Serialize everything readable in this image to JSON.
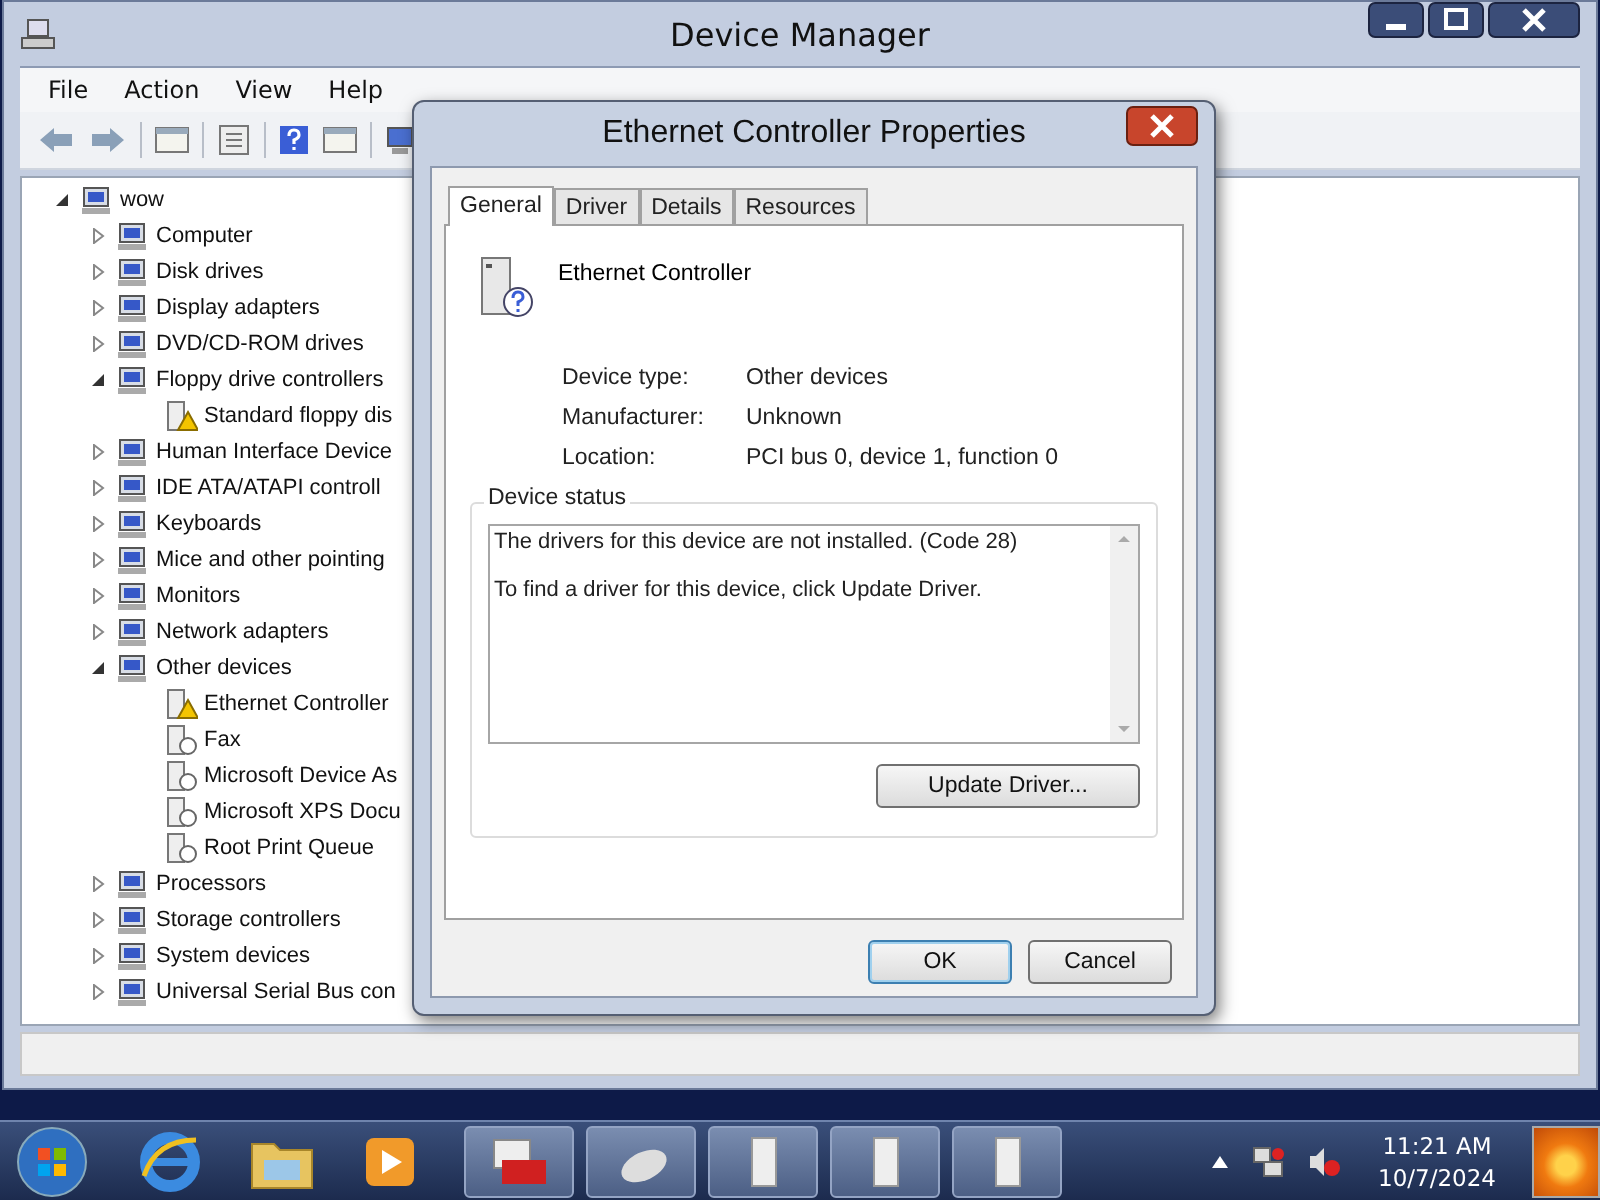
{
  "window": {
    "title": "Device Manager"
  },
  "menu": [
    "File",
    "Action",
    "View",
    "Help"
  ],
  "tree": {
    "label": "wow",
    "expanded": true,
    "children": [
      {
        "label": "Computer",
        "expanded": false
      },
      {
        "label": "Disk drives",
        "expanded": false
      },
      {
        "label": "Display adapters",
        "expanded": false
      },
      {
        "label": "DVD/CD-ROM drives",
        "expanded": false
      },
      {
        "label": "Floppy drive controllers",
        "expanded": true,
        "children": [
          {
            "label": "Standard floppy dis",
            "warning": true
          }
        ]
      },
      {
        "label": "Human Interface Device",
        "expanded": false
      },
      {
        "label": "IDE ATA/ATAPI controll",
        "expanded": false
      },
      {
        "label": "Keyboards",
        "expanded": false
      },
      {
        "label": "Mice and other pointing",
        "expanded": false
      },
      {
        "label": "Monitors",
        "expanded": false
      },
      {
        "label": "Network adapters",
        "expanded": false
      },
      {
        "label": "Other devices",
        "expanded": true,
        "children": [
          {
            "label": "Ethernet Controller",
            "warning": true
          },
          {
            "label": "Fax",
            "warning": false
          },
          {
            "label": "Microsoft Device As",
            "warning": false
          },
          {
            "label": "Microsoft XPS Docu",
            "warning": false
          },
          {
            "label": "Root Print Queue",
            "warning": false
          }
        ]
      },
      {
        "label": "Processors",
        "expanded": false
      },
      {
        "label": "Storage controllers",
        "expanded": false
      },
      {
        "label": "System devices",
        "expanded": false
      },
      {
        "label": "Universal Serial Bus con",
        "expanded": false
      }
    ]
  },
  "dialog": {
    "title": "Ethernet Controller Properties",
    "tabs": [
      {
        "label": "General",
        "selected": true
      },
      {
        "label": "Driver",
        "selected": false
      },
      {
        "label": "Details",
        "selected": false
      },
      {
        "label": "Resources",
        "selected": false
      }
    ],
    "device_name": "Ethernet Controller",
    "properties": [
      {
        "label": "Device type:",
        "value": "Other devices"
      },
      {
        "label": "Manufacturer:",
        "value": "Unknown"
      },
      {
        "label": "Location:",
        "value": "PCI bus 0, device 1, function 0"
      }
    ],
    "status_label": "Device status",
    "status_lines": [
      "The drivers for this device are not installed. (Code 28)",
      "To find a driver for this device, click Update Driver."
    ],
    "update_button": "Update Driver...",
    "buttons": [
      {
        "label": "OK",
        "default": true
      },
      {
        "label": "Cancel",
        "default": false
      }
    ]
  },
  "taskbar": {
    "time": "11:21 AM",
    "date": "10/7/2024"
  }
}
